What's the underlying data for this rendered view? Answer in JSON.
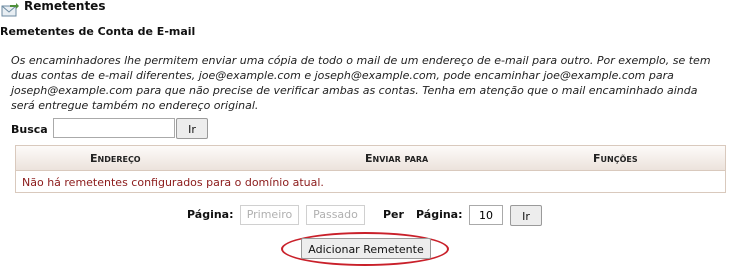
{
  "header": {
    "title": "Remetentes",
    "icon": "envelope-arrow-icon"
  },
  "subtitle": "Remetentes de Conta de E-mail",
  "description": "Os encaminhadores lhe permitem enviar uma cópia de todo o mail de um endereço de e-mail para outro. Por exemplo, se tem duas contas de e-mail diferentes, joe@example.com e joseph@example.com, pode encaminhar joe@example.com para joseph@example.com para que não precise de verificar ambas as contas. Tenha em atenção que o mail encaminhado ainda será entregue também no endereço original.",
  "search": {
    "label": "Busca",
    "value": "",
    "button": "Ir"
  },
  "table": {
    "columns": [
      "Endereço",
      "Enviar para",
      "Funções"
    ],
    "empty_message": "Não há remetentes configurados para o domínio atual."
  },
  "pager": {
    "page_label": "Página:",
    "first": "Primeiro",
    "previous": "Passado",
    "per_label": "Per",
    "per_page_label": "Página:",
    "per_page_value": "10",
    "go": "Ir"
  },
  "add_button": "Adicionar Remetente",
  "colors": {
    "highlight_ellipse": "#c9202a",
    "empty_text": "#8b1a1a"
  }
}
